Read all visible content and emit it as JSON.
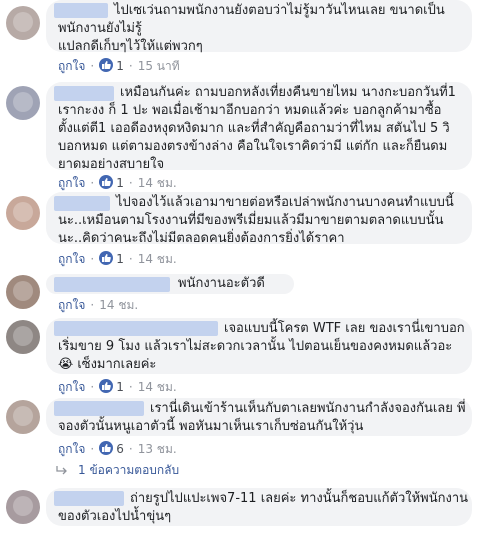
{
  "comments": [
    {
      "text": "ไปเซเว่นถามพนักงานยังตอบว่าไม่รู้มาวันไหนเลย ขนาดเป็นพนักงานยังไม่รู้\nแปลกดีเก็บๆไว้ให้แต่พวกๆ",
      "like": "ถูกใจ",
      "count": "1",
      "time": "15 นาที"
    },
    {
      "text": "เหมือนกันค่ะ ถามบอกหลังเที่ยงคืนขายไหม นางกะบอกวันที่1 เรากะงง ก็ 1 ปะ พอเมื่อเช้ามาอีกบอกว่า หมดแล้วค่ะ บอกลูกค้ามาซื้อตั้งแต่ตี1 เออดีองหงุดหงิดมาก และที่สำคัญคือถามว่าที่ไหม สตันไป 5 วิ บอกหมด แต่ตามองตรงข้างล่าง คือในใจเราคิดว่ามี แต่กัก และก็ยืนดมยาดมอย่างสบายใจ",
      "like": "ถูกใจ",
      "count": "1",
      "time": "14 ชม."
    },
    {
      "text": "ไปจองไว้แล้วเอามาขายต่อหรือเปล่าพนักงานบางคนทำแบบนี้นะ..เหมือนตามโรงงานที่มีของพรีเมี่ยมแล้วมีมาขายตามตลาดแบบนั้นนะ..คิดว่าคนะถึงไม่มีตลอดคนยิ่งต้องการยิ่งได้ราคา",
      "like": "ถูกใจ",
      "count": "1",
      "time": "14 ชม."
    },
    {
      "text": "พนักงานอะตัวดี",
      "like": "ถูกใจ",
      "count": "",
      "time": "14 ชม."
    },
    {
      "text": "เจอแบบนี้โครต WTF เลย ของเรานี่เขาบอกเริ่มขาย 9 โมง แล้วเราไม่สะดวกเวลานั้น ไปตอนเย็นของคงหมดแล้วอะ 😭 เซ็งมากเลยค่ะ",
      "like": "ถูกใจ",
      "count": "1",
      "time": "14 ชม."
    },
    {
      "text": "เรานี่เดินเข้าร้านเห็นกับตาเลยพนักงานกำลังจองกันเลย พี่จองตัวนั้นหนูเอาตัวนี้ พอหันมาเห็นเราเก็บซ่อนกันให้วุ่น",
      "like": "ถูกใจ",
      "count": "6",
      "time": "13 ชม."
    },
    {
      "text": "ถ่ายรูปไปแปะเพจ7-11 เลยค่ะ ทางนั้นก็ชอบแก้ตัวให้พนักงานของตัวเองไปน้ำขุ่นๆ",
      "like": "",
      "count": "",
      "time": ""
    }
  ],
  "reply_link": "1 ข้อความตอบกลับ",
  "colors": {
    "bubble": "#f2f3f5",
    "link": "#385898",
    "like_badge": "#4267b2",
    "meta": "#90949c"
  }
}
